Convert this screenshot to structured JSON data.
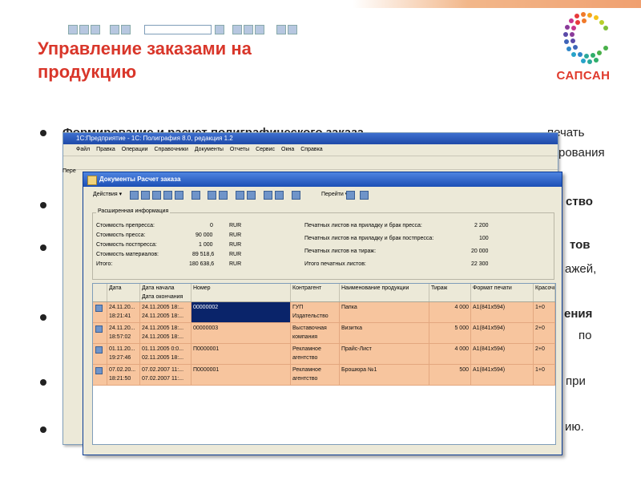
{
  "slide": {
    "title": "Управление заказами на продукцию",
    "logo_text": "САПСАН",
    "colors": {
      "title": "#d9362a",
      "logo": "#e03a2c",
      "row_highlight": "#f7c59e",
      "selection": "#0a246a"
    }
  },
  "bullets": {
    "b1_bold": "Формирование и расчет полиграфического заказа,",
    "b1_rest": "печать",
    "fragments": {
      "f1": "рования",
      "f2": "ство",
      "f3": "тов",
      "f4": "ажей,",
      "f5": "ения",
      "f6": "по",
      "f7": "при",
      "f8": "ию."
    }
  },
  "back_window": {
    "title": "1С:Предприятие - 1С: Полиграфия 8.0, редакция 1.2",
    "menu": [
      "Файл",
      "Правка",
      "Операции",
      "Справочники",
      "Документы",
      "Отчеты",
      "Сервис",
      "Окна",
      "Справка"
    ],
    "side_label": "Пере"
  },
  "window": {
    "title": "Документы Расчет заказа",
    "actions_label": "Действия ▾",
    "goto_label": "Перейти ▾",
    "info": {
      "title": "Расширенная информация",
      "left": [
        {
          "label": "Стоимость препресса:",
          "value": "0",
          "cur": "RUR"
        },
        {
          "label": "Стоимость пресса:",
          "value": "90 000",
          "cur": "RUR"
        },
        {
          "label": "Стоимость постпресса:",
          "value": "1 000",
          "cur": "RUR"
        },
        {
          "label": "Стоимость материалов:",
          "value": "89 518,6",
          "cur": "RUR"
        },
        {
          "label": "Итого:",
          "value": "180 638,6",
          "cur": "RUR"
        }
      ],
      "right": [
        {
          "label": "Печатных листов на приладку и брак пресса:",
          "value": "2 200"
        },
        {
          "label": "Печатных листов на приладку и брак постпресса:",
          "value": "100"
        },
        {
          "label": "Печатных листов на тираж:",
          "value": "20 000"
        },
        {
          "label": "Итого печатных листов:",
          "value": "22 300"
        }
      ]
    },
    "grid": {
      "headers": {
        "date": "Дата",
        "start": "Дата начала",
        "end": "Дата окончания",
        "number": "Номер",
        "contractor": "Контрагент",
        "product": "Наименование продукции",
        "circulation": "Тираж",
        "format": "Формат печати",
        "color": "Красочно"
      },
      "rows": [
        {
          "date1": "24.11.20...",
          "date2": "18:21:41",
          "start": "24.11.2005 18:...",
          "end": "24.11.2005 18:...",
          "number": "00000002",
          "contr1": "ГУП",
          "contr2": "Издательство",
          "product": "Папка",
          "circ": "4 000",
          "format": "А1(841x594)",
          "color": "1+0"
        },
        {
          "date1": "24.11.20...",
          "date2": "18:57:02",
          "start": "24.11.2005 18:...",
          "end": "24.11.2005 18:...",
          "number": "00000003",
          "contr1": "Выставочная",
          "contr2": "компания",
          "product": "Визитка",
          "circ": "5 000",
          "format": "А1(841x594)",
          "color": "2+0"
        },
        {
          "date1": "01.11.20...",
          "date2": "19:27:46",
          "start": "01.11.2005 0:0...",
          "end": "02.11.2005 18:...",
          "number": "П0000001",
          "contr1": "Рекламное",
          "contr2": "агентство",
          "product": "Прайс-Лист",
          "circ": "4 000",
          "format": "А1(841x594)",
          "color": "2+0"
        },
        {
          "date1": "07.02.20...",
          "date2": "18:21:50",
          "start": "07.02.2007 11:...",
          "end": "07.02.2007 11:...",
          "number": "П0000001",
          "contr1": "Рекламное",
          "contr2": "агентство",
          "product": "Брошюра №1",
          "circ": "500",
          "format": "А1(841x594)",
          "color": "1+0"
        }
      ]
    }
  }
}
